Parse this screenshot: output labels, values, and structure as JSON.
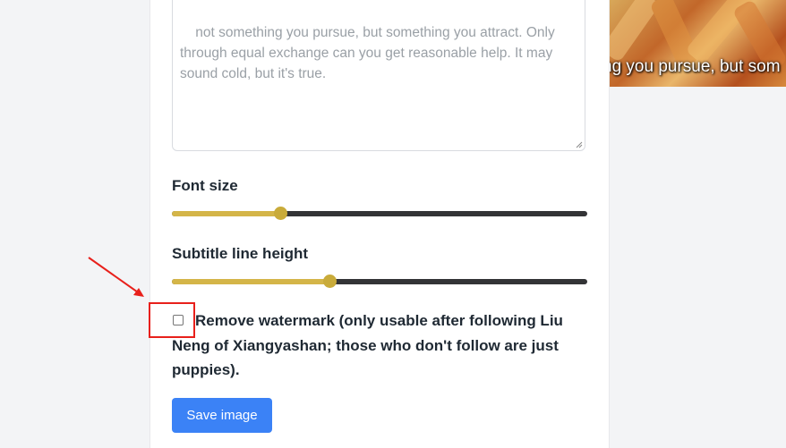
{
  "editor": {
    "subtitle_text": "not something you pursue, but something you attract. Only through equal exchange can you get reasonable help. It may sound cold, but it's true.",
    "font_size_label": "Font size",
    "font_size_value_fraction": 0.26,
    "line_height_label": "Subtitle line height",
    "line_height_value_fraction": 0.38,
    "remove_watermark_label": "Remove watermark (only usable after following Liu Neng of Xiangyashan; those who don't follow are just puppies).",
    "remove_watermark_checked": false,
    "save_button_label": "Save image"
  },
  "preview": {
    "caption": "ng you pursue, but som"
  },
  "colors": {
    "slider_accent": "#d4b548",
    "slider_accent_fill": "#c9ab3a",
    "button_blue": "#3b82f6",
    "annotation_red": "#e8201b"
  }
}
